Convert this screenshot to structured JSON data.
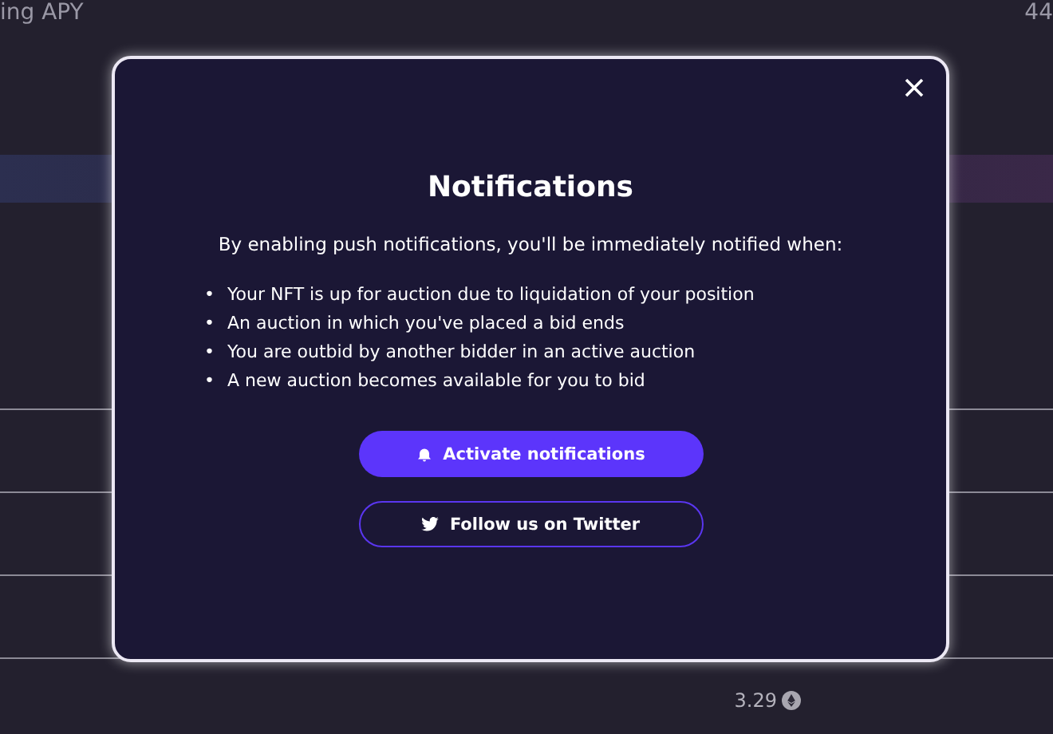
{
  "background": {
    "header_label": "ing APY",
    "header_value": "44",
    "price": "3.29"
  },
  "modal": {
    "title": "Notifications",
    "intro": "By enabling push notifications, you'll be immediately notified when:",
    "items": [
      {
        "bullet": "•",
        "text": "Your NFT is up for auction due to liquidation of your position"
      },
      {
        "bullet": "•",
        "text": "An auction in which you've placed a bid ends"
      },
      {
        "bullet": "•",
        "text": "You are outbid by another bidder in an active auction"
      },
      {
        "bullet": "•",
        "text": "A new auction becomes available for you to bid"
      }
    ],
    "buttons": [
      {
        "kind": "primary",
        "label": "Activate notifications"
      },
      {
        "kind": "outline",
        "label": "Follow us on Twitter"
      }
    ]
  }
}
